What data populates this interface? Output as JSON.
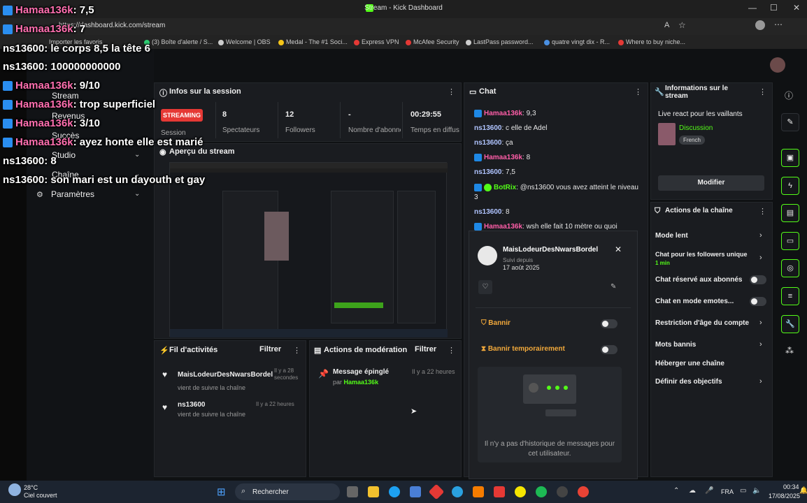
{
  "browser": {
    "title": "Stream - Kick Dashboard",
    "url": "https://dashboard.kick.com/stream",
    "bookmarks": [
      "Importer les favoris",
      "(3) Boîte d'alerte / S...",
      "Welcome | OBS",
      "Medal - The #1 Soci...",
      "Express VPN",
      "McAfee Security",
      "LastPass password...",
      "quatre vingt dix - R...",
      "Where to buy niche..."
    ]
  },
  "nav": {
    "items": [
      "Stream",
      "Revenus",
      "Succès",
      "Studio",
      "Chaîne",
      "Paramètres"
    ]
  },
  "session": {
    "title": "Infos sur la session",
    "badge": "STREAMING",
    "stats": [
      {
        "value": "8",
        "label": "Spectateurs"
      },
      {
        "value": "12",
        "label": "Followers"
      },
      {
        "value": "-",
        "label": "Nombre d'abonnés"
      },
      {
        "value": "00:29:55",
        "label": "Temps en diffusion"
      }
    ],
    "session_label": "Session"
  },
  "preview": {
    "title": "Aperçu du stream"
  },
  "activity": {
    "title": "Fil d'activités",
    "filter": "Filtrer",
    "items": [
      {
        "user": "MaisLodeurDesNwarsBordel",
        "sub": "vient de suivre la chaîne",
        "time": "Il y a 28 secondes"
      },
      {
        "user": "ns13600",
        "sub": "vient de suivre la chaîne",
        "time": "Il y a 22 heures"
      }
    ]
  },
  "moderation": {
    "title": "Actions de modération",
    "filter": "Filtrer",
    "item_title": "Message épinglé",
    "item_by": "par",
    "item_user": "Hamaa136k",
    "item_time": "Il y a 22 heures"
  },
  "chat": {
    "title": "Chat",
    "lines": [
      {
        "user": "Hamaa136k",
        "text": ": 9,3",
        "style": "pink",
        "badge": true
      },
      {
        "user": "ns13600",
        "text": ": c elle de Adel",
        "style": "blue",
        "badge": false
      },
      {
        "user": "ns13600",
        "text": ": ça",
        "style": "blue",
        "badge": false
      },
      {
        "user": "Hamaa136k",
        "text": ": 8",
        "style": "pink",
        "badge": true
      },
      {
        "user": "ns13600",
        "text": ": 7,5",
        "style": "blue",
        "badge": false
      },
      {
        "user": "BotRix",
        "text": ": @ns13600 vous avez atteint le niveau",
        "style": "green",
        "badge": true
      },
      {
        "user": "",
        "text": "3",
        "style": "plain",
        "badge": false
      },
      {
        "user": "ns13600",
        "text": ": 8",
        "style": "blue",
        "badge": false
      },
      {
        "user": "Hamaa136k",
        "text": ": wsh elle fait 10 mètre ou quoi",
        "style": "pink",
        "badge": true
      }
    ]
  },
  "user_card": {
    "name": "MaisLodeurDesNwarsBordel",
    "followed_label": "Suivi depuis",
    "followed_date": "17 août 2025",
    "ban": "Bannir",
    "timeout": "Bannir temporairement",
    "empty": "Il n'y a pas d'historique de messages pour cet utilisateur."
  },
  "stream_info": {
    "title": "Informations sur le stream",
    "stream_title": "Live react pour les vaillants",
    "category": "Discussion",
    "tag": "French",
    "edit": "Modifier"
  },
  "channel_actions": {
    "title": "Actions de la chaîne",
    "rows": [
      {
        "label": "Mode lent",
        "type": "chevron"
      },
      {
        "label": "Chat pour les followers unique",
        "sub": "1 min",
        "type": "chevron"
      },
      {
        "label": "Chat réservé aux abonnés",
        "type": "toggle"
      },
      {
        "label": "Chat en mode emotes...",
        "type": "toggle"
      },
      {
        "label": "Restriction d'âge du compte",
        "type": "chevron"
      },
      {
        "label": "Mots bannis",
        "type": "chevron"
      },
      {
        "label": "Héberger une chaîne",
        "type": "none"
      },
      {
        "label": "Définir des objectifs",
        "type": "chevron"
      }
    ]
  },
  "overlay": {
    "lines": [
      {
        "user": "Hamaa136k",
        "text": ": 7,5"
      },
      {
        "user": "Hamaa136k",
        "text": ": 7"
      },
      {
        "user": "ns13600",
        "text": ": le corps 8,5 la tête 6"
      },
      {
        "user": "ns13600",
        "text": ": 100000000000"
      },
      {
        "user": "Hamaa136k",
        "text": ": 9/10"
      },
      {
        "user": "Hamaa136k",
        "text": ": trop superficiel"
      },
      {
        "user": "Hamaa136k",
        "text": ": 3/10"
      },
      {
        "user": "Hamaa136k",
        "text": ": ayez honte elle est marié"
      },
      {
        "user": "ns13600",
        "text": ": 8"
      },
      {
        "user": "ns13600",
        "text": ": son mari est un dayouth et gay"
      }
    ]
  },
  "taskbar": {
    "weather_temp": "28°C",
    "weather_desc": "Ciel couvert",
    "search": "Rechercher",
    "lang": "FRA",
    "time": "00:34",
    "date": "17/08/2025"
  },
  "colors": {
    "accent": "#53fc18",
    "danger": "#e53935"
  }
}
